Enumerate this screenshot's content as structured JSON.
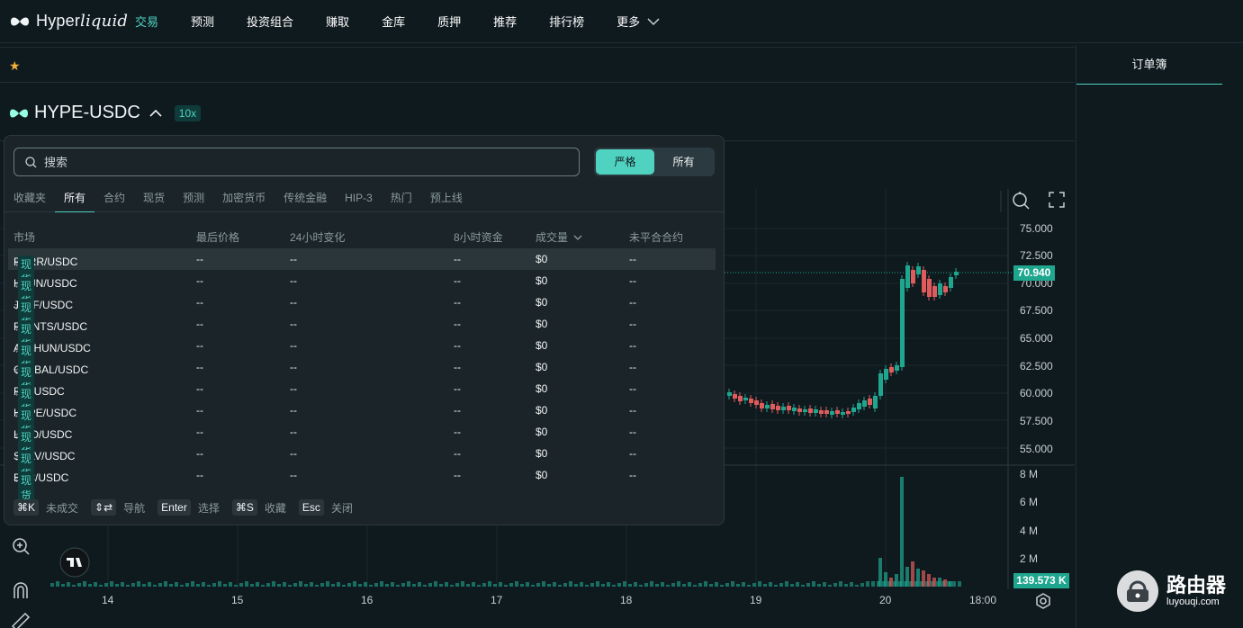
{
  "nav": {
    "logo": "Hyperliquid",
    "items": [
      "交易",
      "预测",
      "投资组合",
      "赚取",
      "金库",
      "质押",
      "推荐",
      "排行榜"
    ],
    "more": "更多"
  },
  "right_panel": {
    "tab": "订单簿"
  },
  "pair": {
    "name": "HYPE-USDC",
    "leverage": "10x"
  },
  "search": {
    "placeholder": "搜索",
    "toggle": [
      "严格",
      "所有"
    ],
    "categories": [
      "收藏夹",
      "所有",
      "合约",
      "现货",
      "预测",
      "加密货币",
      "传统金融",
      "HIP-3",
      "热门",
      "预上线"
    ],
    "active_category": "所有",
    "columns": [
      "市场",
      "最后价格",
      "24小时变化",
      "8小时资金",
      "成交量",
      "未平合合约"
    ],
    "rows": [
      {
        "market": "PURR/USDC",
        "badge": "现货",
        "price": "--",
        "change": "--",
        "funding": "--",
        "volume": "$0",
        "oi": "--"
      },
      {
        "market": "HFUN/USDC",
        "badge": "现货",
        "price": "--",
        "change": "--",
        "funding": "--",
        "volume": "$0",
        "oi": "--"
      },
      {
        "market": "JEFF/USDC",
        "badge": "现货",
        "price": "--",
        "change": "--",
        "funding": "--",
        "volume": "$0",
        "oi": "--"
      },
      {
        "market": "POINTS/USDC",
        "badge": "现货",
        "price": "--",
        "change": "--",
        "funding": "--",
        "volume": "$0",
        "oi": "--"
      },
      {
        "market": "ATEHUN/USDC",
        "badge": "现货",
        "price": "--",
        "change": "--",
        "funding": "--",
        "volume": "$0",
        "oi": "--"
      },
      {
        "market": "CATBAL/USDC",
        "badge": "现货",
        "price": "--",
        "change": "--",
        "funding": "--",
        "volume": "$0",
        "oi": "--"
      },
      {
        "market": "PIP/USDC",
        "badge": "现货",
        "price": "--",
        "change": "--",
        "funding": "--",
        "volume": "$0",
        "oi": "--"
      },
      {
        "market": "HYPE/USDC",
        "badge": "现货",
        "price": "--",
        "change": "--",
        "funding": "--",
        "volume": "$0",
        "oi": "--"
      },
      {
        "market": "LIQD/USDC",
        "badge": "现货",
        "price": "--",
        "change": "--",
        "funding": "--",
        "volume": "$0",
        "oi": "--"
      },
      {
        "market": "SOLV/USDC",
        "badge": "现货",
        "price": "--",
        "change": "--",
        "funding": "--",
        "volume": "$0",
        "oi": "--"
      },
      {
        "market": "BTC/USDC",
        "badge": "现货",
        "price": "--",
        "change": "--",
        "funding": "--",
        "volume": "$0",
        "oi": "--"
      }
    ],
    "shortcuts": [
      {
        "key": "⌘K",
        "label": "未成交"
      },
      {
        "key": "⇕⇄",
        "label": "导航"
      },
      {
        "key": "Enter",
        "label": "选择"
      },
      {
        "key": "⌘S",
        "label": "收藏"
      },
      {
        "key": "Esc",
        "label": "关闭"
      }
    ]
  },
  "chart": {
    "price_axis": [
      "75.000",
      "72.500",
      "70.000",
      "67.500",
      "65.000",
      "62.500",
      "60.000",
      "57.500",
      "55.000"
    ],
    "volume_axis": [
      "8 M",
      "6 M",
      "4 M",
      "2 M"
    ],
    "time_axis": [
      "14",
      "15",
      "16",
      "17",
      "18",
      "19",
      "20",
      "18:00"
    ],
    "last_price": "70.940",
    "last_volume": "139.573 K"
  },
  "watermark": {
    "title": "路由器",
    "subtitle": "luyouqi.com"
  },
  "colors": {
    "accent": "#50d2c1",
    "up": "#1fa68f",
    "down": "#e05c5c"
  }
}
